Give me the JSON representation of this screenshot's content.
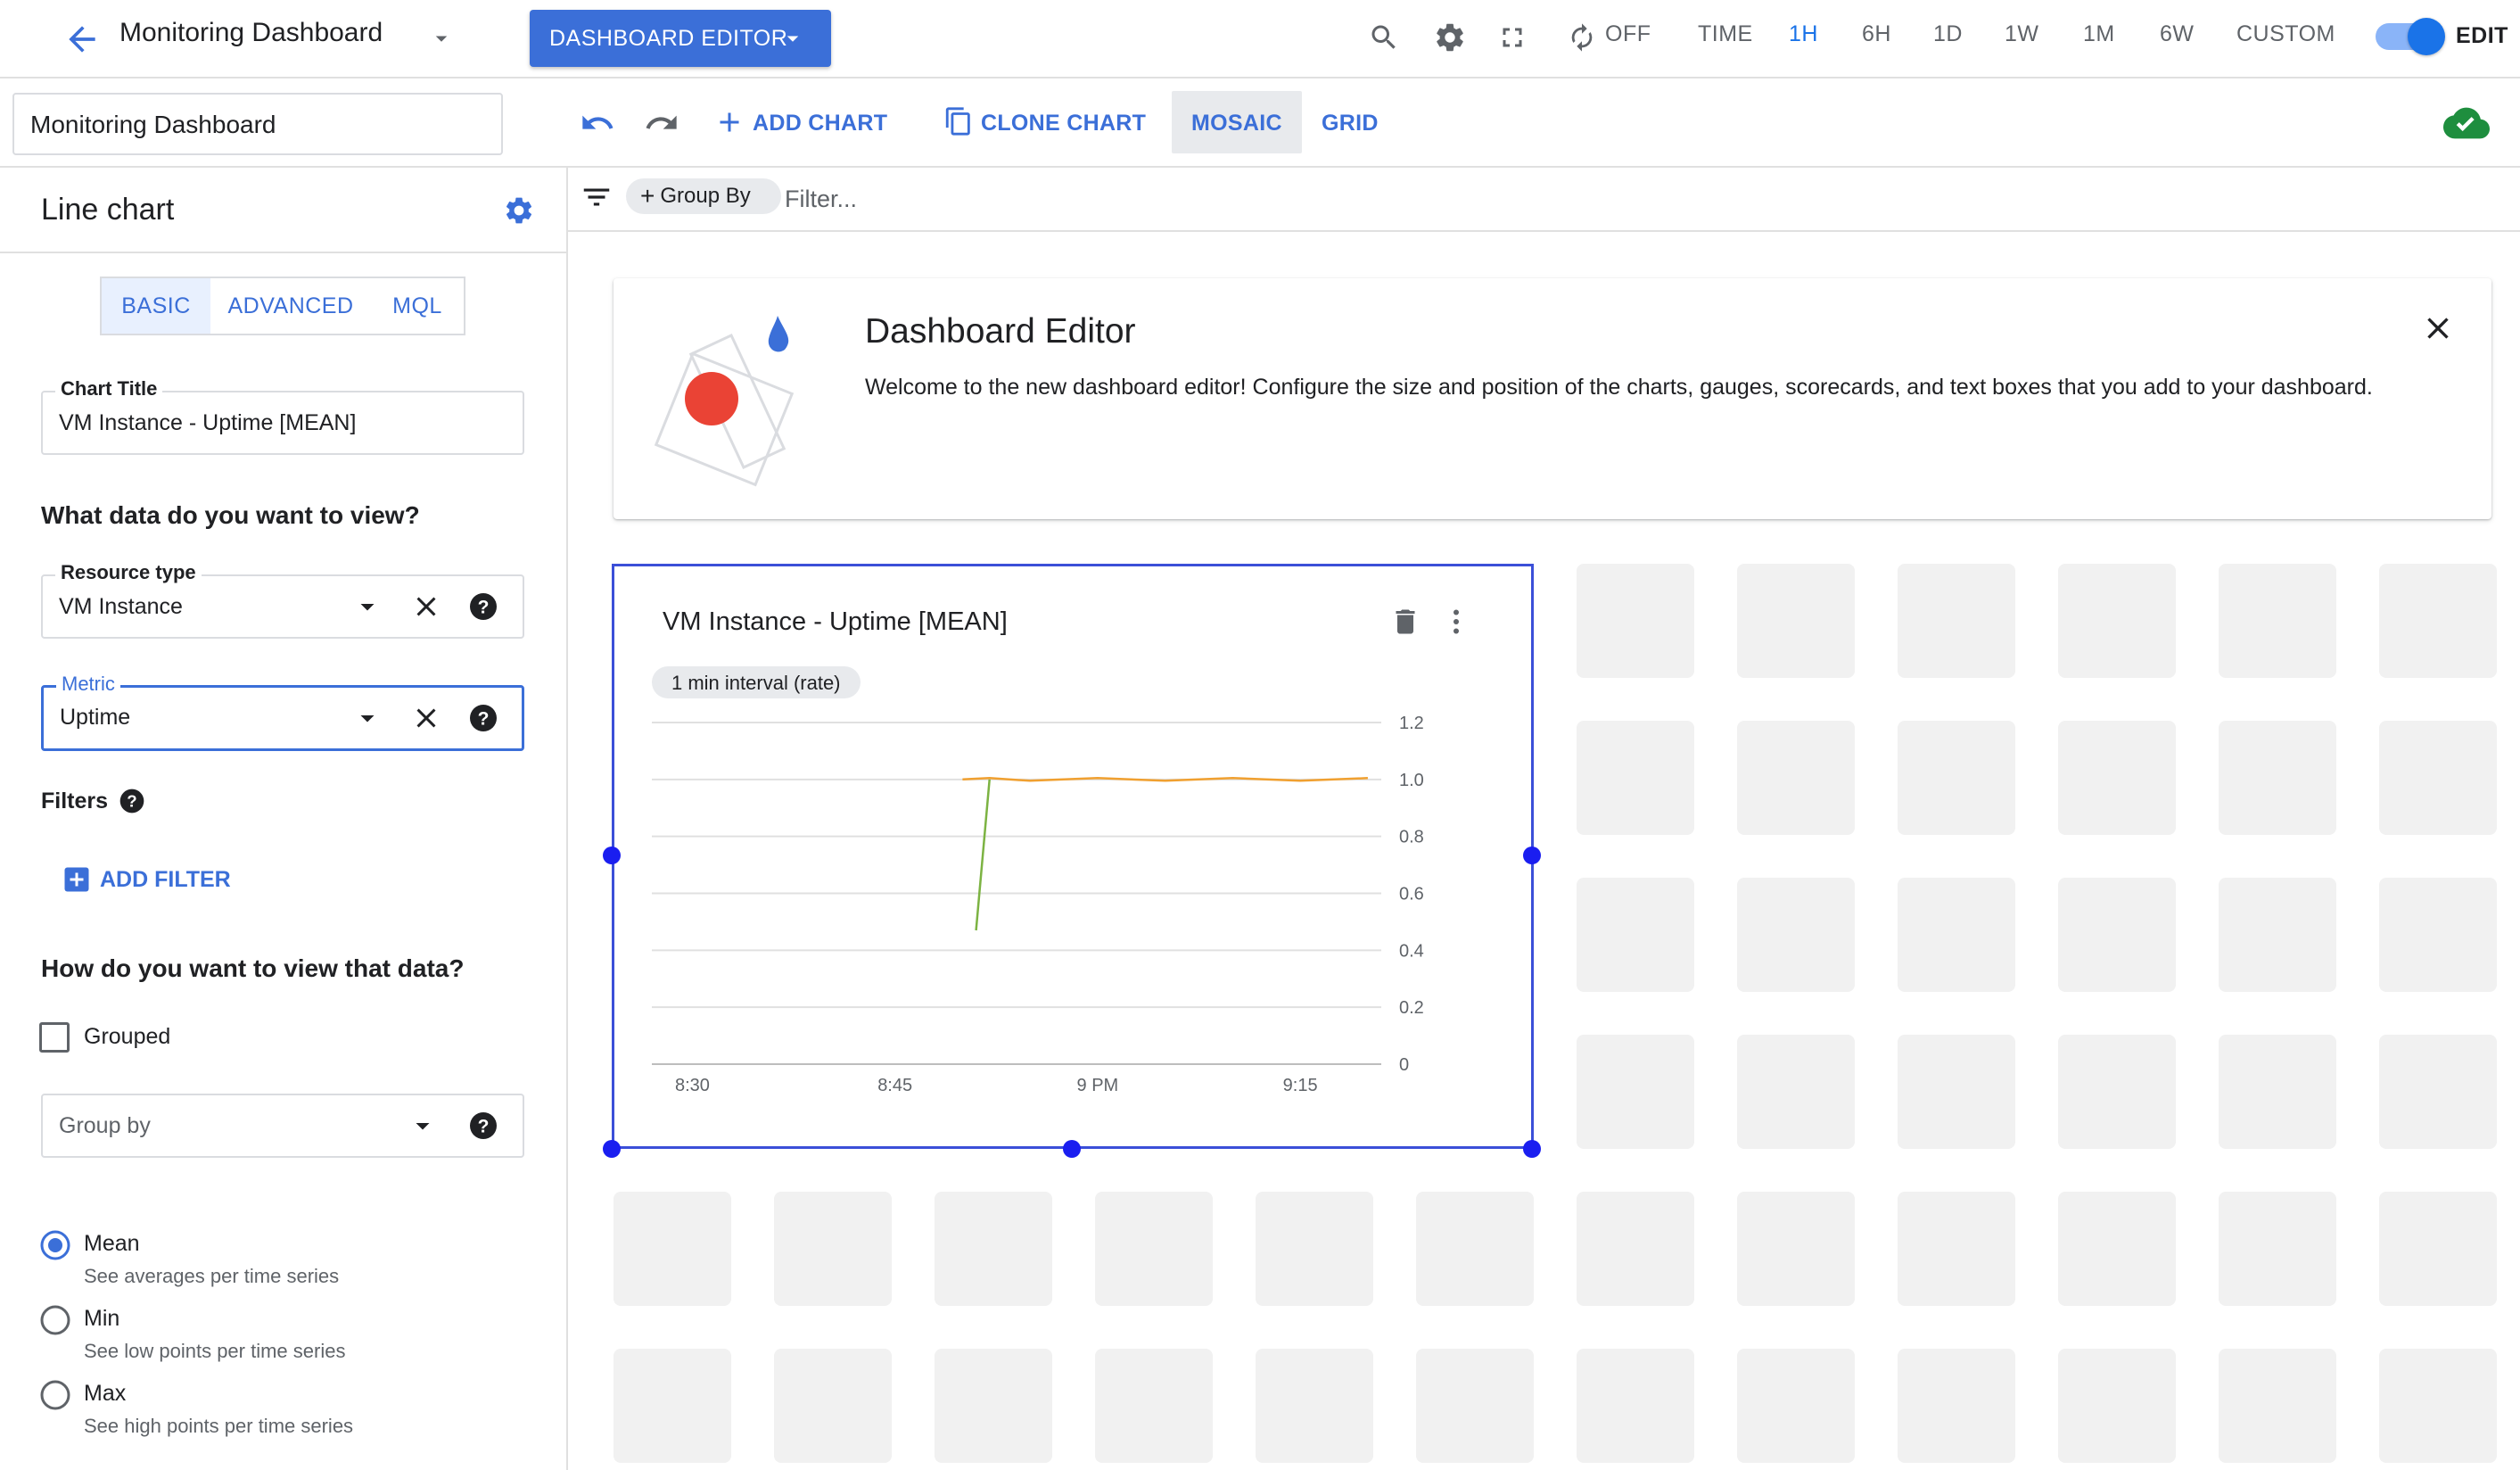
{
  "header": {
    "title": "Monitoring Dashboard",
    "editor_button": "DASHBOARD EDITOR",
    "refresh_label": "OFF",
    "time_label": "TIME",
    "time_ranges": [
      "1H",
      "6H",
      "1D",
      "1W",
      "1M",
      "6W",
      "CUSTOM"
    ],
    "selected_range": "1H",
    "edit_label": "EDIT",
    "edit_on": true,
    "accent_color": "#1a73e8"
  },
  "toolbar": {
    "dashboard_name": "Monitoring Dashboard",
    "add_chart": "ADD CHART",
    "clone_chart": "CLONE CHART",
    "mosaic": "MOSAIC",
    "grid": "GRID",
    "selected_layout": "MOSAIC"
  },
  "filterbar": {
    "group_by": "Group By",
    "filter_placeholder": "Filter..."
  },
  "left_panel": {
    "title": "Line chart",
    "tabs": [
      "BASIC",
      "ADVANCED",
      "MQL"
    ],
    "selected_tab": "BASIC",
    "chart_title_label": "Chart Title",
    "chart_title_value": "VM Instance - Uptime [MEAN]",
    "data_heading": "What data do you want to view?",
    "resource_label": "Resource type",
    "resource_value": "VM Instance",
    "metric_label": "Metric",
    "metric_value": "Uptime",
    "filters_label": "Filters",
    "add_filter": "ADD FILTER",
    "view_heading": "How do you want to view that data?",
    "grouped_label": "Grouped",
    "grouped_checked": false,
    "group_by_placeholder": "Group by",
    "aggregations": [
      {
        "label": "Mean",
        "desc": "See averages per time series",
        "selected": true
      },
      {
        "label": "Min",
        "desc": "See low points per time series",
        "selected": false
      },
      {
        "label": "Max",
        "desc": "See high points per time series",
        "selected": false
      }
    ]
  },
  "banner": {
    "title": "Dashboard Editor",
    "text": "Welcome to the new dashboard editor! Configure the size and position of the charts, gauges, scorecards, and text boxes that you add to your dashboard."
  },
  "chart_card": {
    "title": "VM Instance - Uptime [MEAN]",
    "interval": "1 min interval (rate)"
  },
  "chart_data": {
    "type": "line",
    "title": "VM Instance - Uptime [MEAN]",
    "xlabel": "",
    "ylabel": "",
    "x_ticks": [
      "8:30",
      "8:45",
      "9 PM",
      "9:15"
    ],
    "y_ticks": [
      "1.2",
      "1.0",
      "0.8",
      "0.6",
      "0.4",
      "0.2",
      "0"
    ],
    "ylim": [
      0,
      1.2
    ],
    "xlim": [
      "8:27",
      "9:21"
    ],
    "grid": true,
    "series": [
      {
        "color": "#7cb342",
        "x": [
          "8:51",
          "8:52"
        ],
        "y": [
          0.47,
          1.0
        ]
      },
      {
        "color": "#f0a030",
        "x": [
          "8:50",
          "8:52",
          "8:55",
          "9:00",
          "9:05",
          "9:10",
          "9:15",
          "9:20"
        ],
        "y": [
          1.0,
          1.0,
          1.0,
          1.0,
          1.0,
          1.0,
          1.0,
          1.0
        ]
      }
    ]
  }
}
